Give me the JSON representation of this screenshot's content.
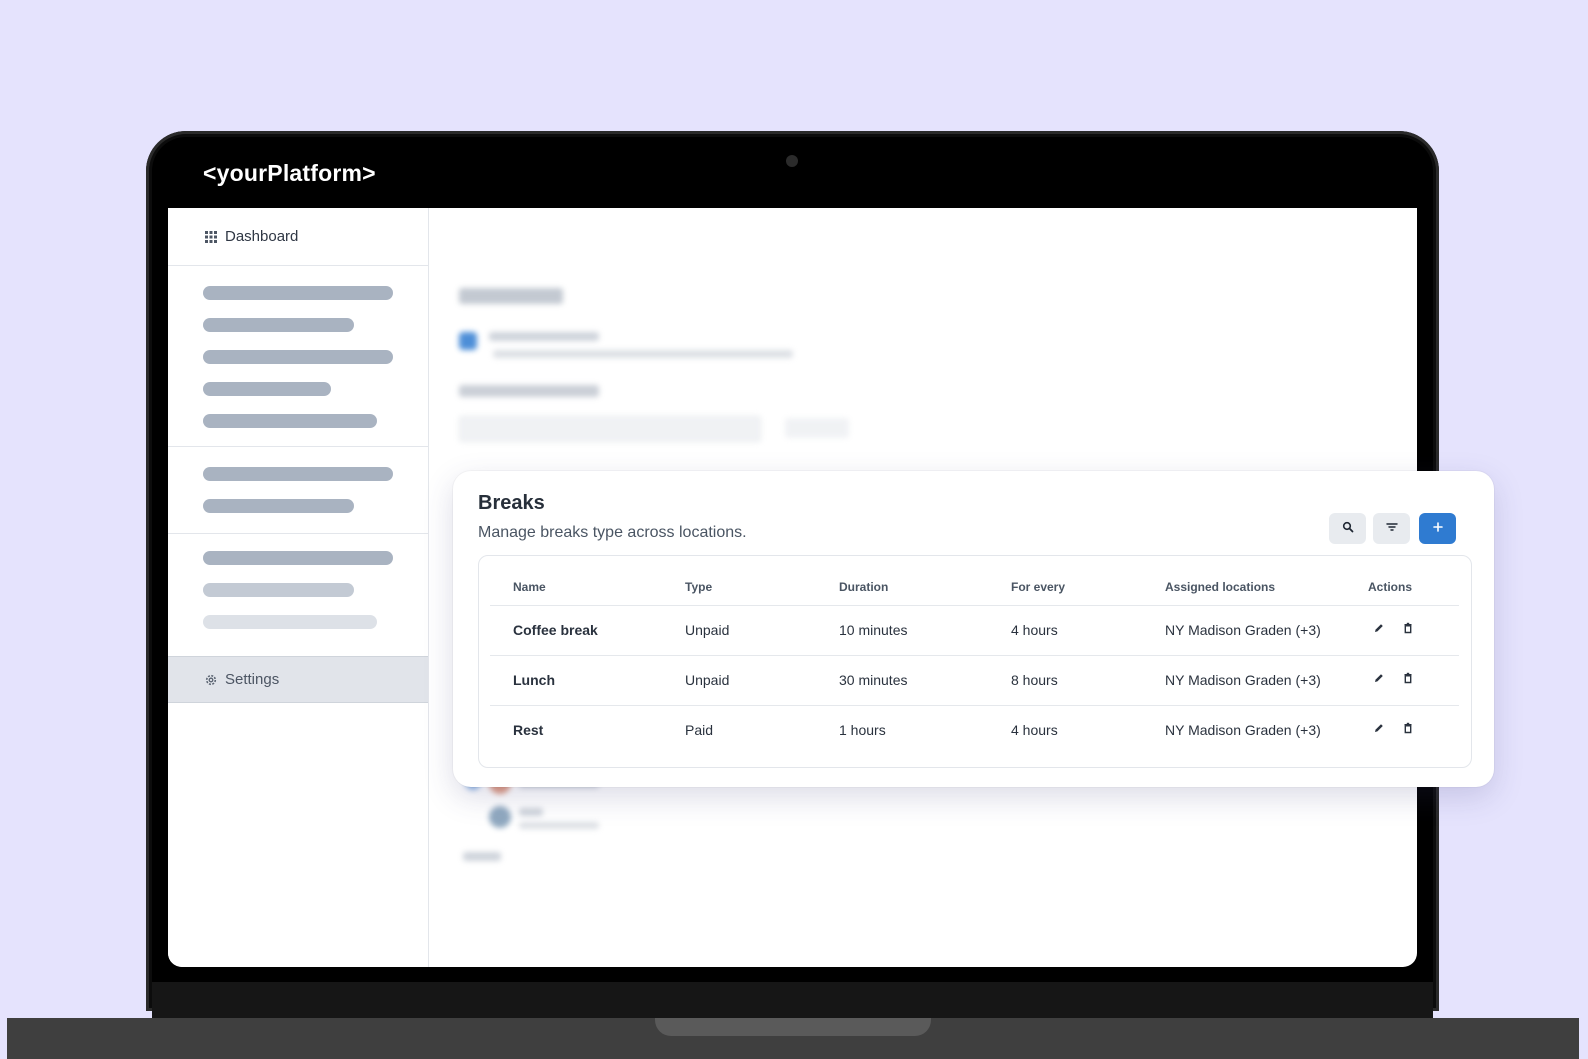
{
  "brand": {
    "logo_text": "<yourPlatform>"
  },
  "sidebar": {
    "dashboard_label": "Dashboard",
    "settings_label": "Settings"
  },
  "breaks_card": {
    "title": "Breaks",
    "subtitle": "Manage breaks type across locations.",
    "toolbar": {
      "search_icon": "search-icon",
      "filter_icon": "filter-icon",
      "add_icon": "plus-icon"
    },
    "columns": [
      "Name",
      "Type",
      "Duration",
      "For every",
      "Assigned locations",
      "Actions"
    ],
    "rows": [
      {
        "name": "Coffee break",
        "type": "Unpaid",
        "duration": "10 minutes",
        "for_every": "4 hours",
        "locations": "NY Madison Graden (+3)"
      },
      {
        "name": "Lunch",
        "type": "Unpaid",
        "duration": "30 minutes",
        "for_every": "8 hours",
        "locations": "NY Madison Graden (+3)"
      },
      {
        "name": "Rest",
        "type": "Paid",
        "duration": "1 hours",
        "for_every": "4 hours",
        "locations": "NY Madison Graden (+3)"
      }
    ]
  },
  "colors": {
    "background": "#e5e3fd",
    "primary": "#2f7bd1",
    "settings_active": "#e1e4ea"
  }
}
